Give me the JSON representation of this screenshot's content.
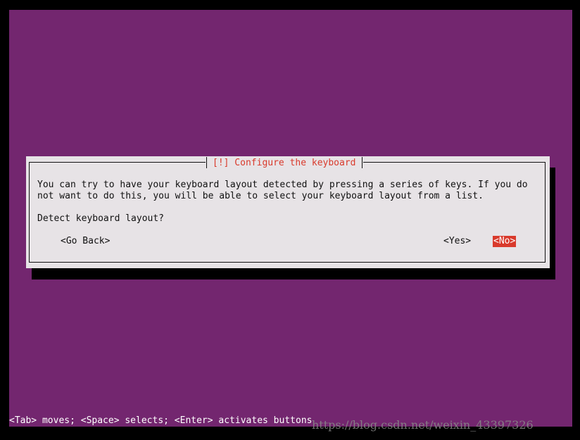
{
  "dialog": {
    "title": "[!] Configure the keyboard",
    "message_line1": "You can try to have your keyboard layout detected by pressing a series of keys. If you do",
    "message_line2": "not want to do this, you will be able to select your keyboard layout from a list.",
    "question": "Detect keyboard layout?",
    "buttons": {
      "go_back": "<Go Back>",
      "yes": "<Yes>",
      "no": "<No>"
    },
    "selected_button": "no"
  },
  "status_bar": "<Tab> moves; <Space> selects; <Enter> activates buttons",
  "watermark": "https://blog.csdn.net/weixin_43397326",
  "colors": {
    "background": "#73266f",
    "dialog": "#e7e3e6",
    "accent": "#d93a2c"
  }
}
